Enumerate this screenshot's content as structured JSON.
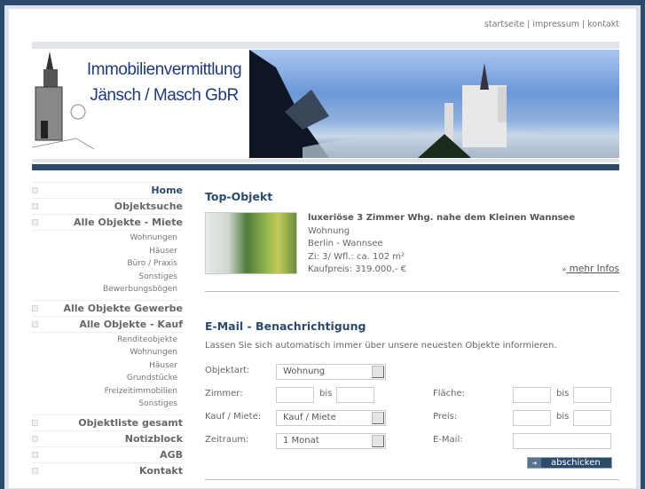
{
  "top_links": [
    "startseite",
    "impressum",
    "kontakt"
  ],
  "brand": {
    "line1": "Immobilienvermittlung",
    "line2": "Jänsch / Masch GbR"
  },
  "nav": [
    {
      "label": "Home",
      "active": true
    },
    {
      "label": "Objektsuche"
    },
    {
      "label": "Alle Objekte - Miete",
      "sub": [
        "Wohnungen",
        "Häuser",
        "Büro / Praxis",
        "Sonstiges",
        "Bewerbungsbögen"
      ]
    },
    {
      "label": "Alle Objekte Gewerbe"
    },
    {
      "label": "Alle Objekte - Kauf",
      "sub": [
        "Renditeobjekte",
        "Wohnungen",
        "Häuser",
        "Grundstücke",
        "Freizeitimmobilien",
        "Sonstiges"
      ]
    },
    {
      "label": "Objektliste gesamt"
    },
    {
      "label": "Notizblock"
    },
    {
      "label": "AGB"
    },
    {
      "label": "Kontakt"
    }
  ],
  "top_object": {
    "heading": "Top-Objekt",
    "title": "luxeriöse 3 Zimmer Whg. nahe dem Kleinen Wannsee",
    "type": "Wohnung",
    "location": "Berlin - Wannsee",
    "rooms": "Zi: 3/ Wfl.: ca. 102 m²",
    "price": "Kaufpreis: 319.000,- €",
    "more": "mehr Infos"
  },
  "notification": {
    "heading": "E-Mail - Benachrichtigung",
    "intro": "Lassen Sie sich automatisch immer über unsere neuesten Objekte informieren.",
    "objektart_label": "Objektart:",
    "objektart_value": "Wohnung",
    "zimmer_label": "Zimmer:",
    "bis": "bis",
    "kauf_label": "Kauf / Miete:",
    "kauf_value": "Kauf / Miete",
    "zeitraum_label": "Zeitraum:",
    "zeitraum_value": "1 Monat",
    "flaeche_label": "Fläche:",
    "preis_label": "Preis:",
    "email_label": "E-Mail:",
    "submit": "abschicken"
  }
}
